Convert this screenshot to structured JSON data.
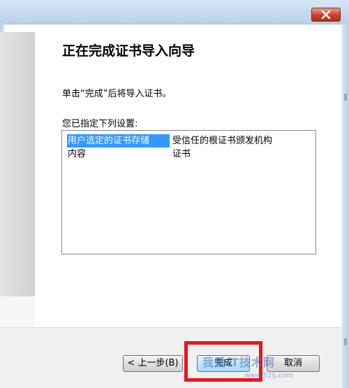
{
  "window": {
    "close_icon": "close-icon"
  },
  "wizard": {
    "heading": "正在完成证书导入向导",
    "instruction": "单击“完成”后将导入证书。",
    "settings_label": "您已指定下列设置:",
    "settings": [
      {
        "key": "用户选定的证书存储",
        "value": "受信任的根证书颁发机构",
        "selected": true
      },
      {
        "key": "内容",
        "value": "证书",
        "selected": false
      }
    ]
  },
  "buttons": {
    "back": "< 上一步(B)",
    "finish": "完成",
    "cancel": "取消"
  },
  "annotation": {
    "highlight_color": "#e8141c"
  },
  "watermark": {
    "text": "我爱IT技术网",
    "url": "www.52ij.com"
  }
}
